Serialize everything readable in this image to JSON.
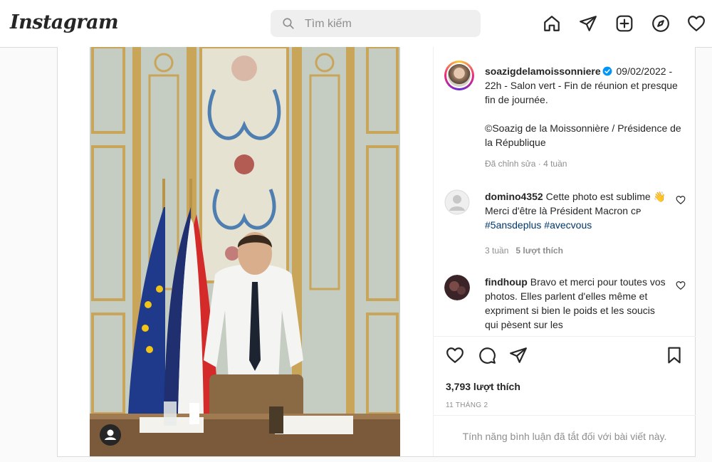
{
  "nav": {
    "logo": "Instagram",
    "search_placeholder": "Tìm kiếm",
    "icons": [
      "home-icon",
      "direct-send-icon",
      "new-post-icon",
      "explore-compass-icon",
      "activity-heart-icon"
    ]
  },
  "post": {
    "author": "soazigdelamoissonniere",
    "verified": true,
    "caption_line1": "09/02/2022 - 22h - Salon vert - Fin de réunion et presque fin de journée.",
    "caption_line2": "©Soazig de la Moissonnière / Présidence de la République",
    "edited_meta": "Đã chỉnh sửa · 4 tuần",
    "likes": "3,793 lượt thích",
    "date": "11 THÁNG 2",
    "comments_disabled": "Tính năng bình luận đã tắt đối với bài viết này."
  },
  "comments": [
    {
      "user": "domino4352",
      "text_before": "Cette photo est sublime 👋 Merci d'être là Président Macron ᴄᴘ ",
      "hashtag1": "#5ansdeplus",
      "hashtag2": "#avecvous",
      "age": "3 tuần",
      "likes": "5 lượt thích"
    },
    {
      "user": "findhoup",
      "text": "Bravo et merci pour toutes vos photos. Elles parlent d'elles même et expriment si bien le poids et les soucis qui pèsent sur les"
    }
  ],
  "colors": {
    "border": "#dbdbdb",
    "secondary_text": "#8e8e8e",
    "hashtag": "#00376b",
    "verified": "#0095f6"
  }
}
